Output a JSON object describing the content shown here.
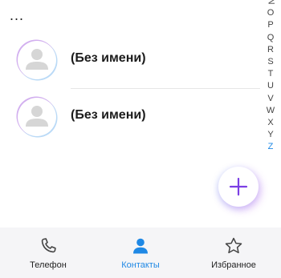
{
  "header": {
    "more_glyph": "..."
  },
  "alpha_index": {
    "letters": [
      "N",
      "O",
      "P",
      "Q",
      "R",
      "S",
      "T",
      "U",
      "V",
      "W",
      "X",
      "Y",
      "Z"
    ],
    "active": "Z"
  },
  "contacts": [
    {
      "name": "(Без имени)"
    },
    {
      "name": "(Без имени)"
    }
  ],
  "fab": {
    "icon": "plus-icon"
  },
  "bottom_nav": {
    "items": [
      {
        "label": "Телефон",
        "icon": "phone-icon",
        "active": false
      },
      {
        "label": "Контакты",
        "icon": "contacts-icon",
        "active": true
      },
      {
        "label": "Избранное",
        "icon": "star-icon",
        "active": false
      }
    ]
  },
  "colors": {
    "accent": "#1e88e5",
    "fab_plus": "#7b3fe4",
    "nav_background": "#f5f5f7"
  }
}
